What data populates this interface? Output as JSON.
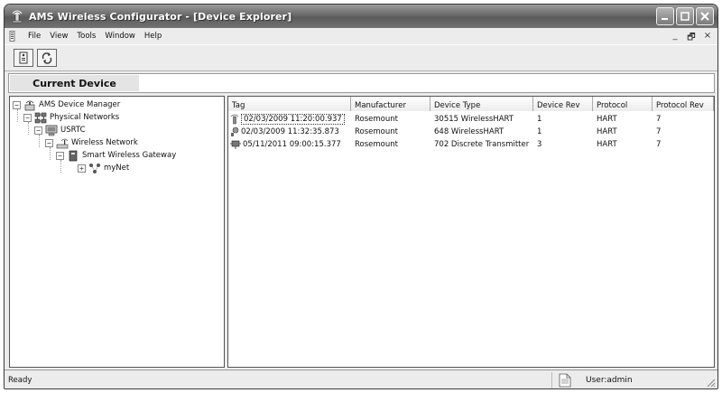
{
  "window": {
    "title": "AMS Wireless Configurator - [Device Explorer]"
  },
  "menubar": {
    "items": [
      "File",
      "View",
      "Tools",
      "Window",
      "Help"
    ],
    "mdi_controls": [
      "_",
      "🗗",
      "×"
    ]
  },
  "current_device": {
    "label": "Current Device",
    "value": ""
  },
  "tree": {
    "nodes": [
      {
        "label": "AMS Device Manager",
        "icon": "ams-device-manager-icon",
        "expander": "−"
      },
      {
        "label": "Physical Networks",
        "icon": "physical-networks-icon",
        "expander": "−"
      },
      {
        "label": "USRTC",
        "icon": "computer-icon",
        "expander": "−"
      },
      {
        "label": "Wireless Network",
        "icon": "wireless-network-icon",
        "expander": "−"
      },
      {
        "label": "Smart Wireless Gateway",
        "icon": "gateway-icon",
        "expander": "−"
      },
      {
        "label": "myNet",
        "icon": "wireless-mesh-icon",
        "expander": "+"
      }
    ]
  },
  "device_list": {
    "columns": [
      "Tag",
      "Manufacturer",
      "Device Type",
      "Device Rev",
      "Protocol",
      "Protocol Rev"
    ],
    "rows": [
      {
        "tag": "02/03/2009 11:20:00.937",
        "manufacturer": "Rosemount",
        "device_type": "30515 WirelessHART",
        "device_rev": "1",
        "protocol": "HART",
        "protocol_rev": "7",
        "icon": "wireless-device-icon"
      },
      {
        "tag": "02/03/2009 11:32:35.873",
        "manufacturer": "Rosemount",
        "device_type": "648 WirelessHART",
        "device_rev": "1",
        "protocol": "HART",
        "protocol_rev": "7",
        "icon": "temperature-transmitter-icon"
      },
      {
        "tag": "05/11/2011 09:00:15.377",
        "manufacturer": "Rosemount",
        "device_type": "702 Discrete Transmitter",
        "device_rev": "3",
        "protocol": "HART",
        "protocol_rev": "7",
        "icon": "discrete-transmitter-icon"
      }
    ]
  },
  "statusbar": {
    "status": "Ready",
    "user": "User:admin"
  }
}
